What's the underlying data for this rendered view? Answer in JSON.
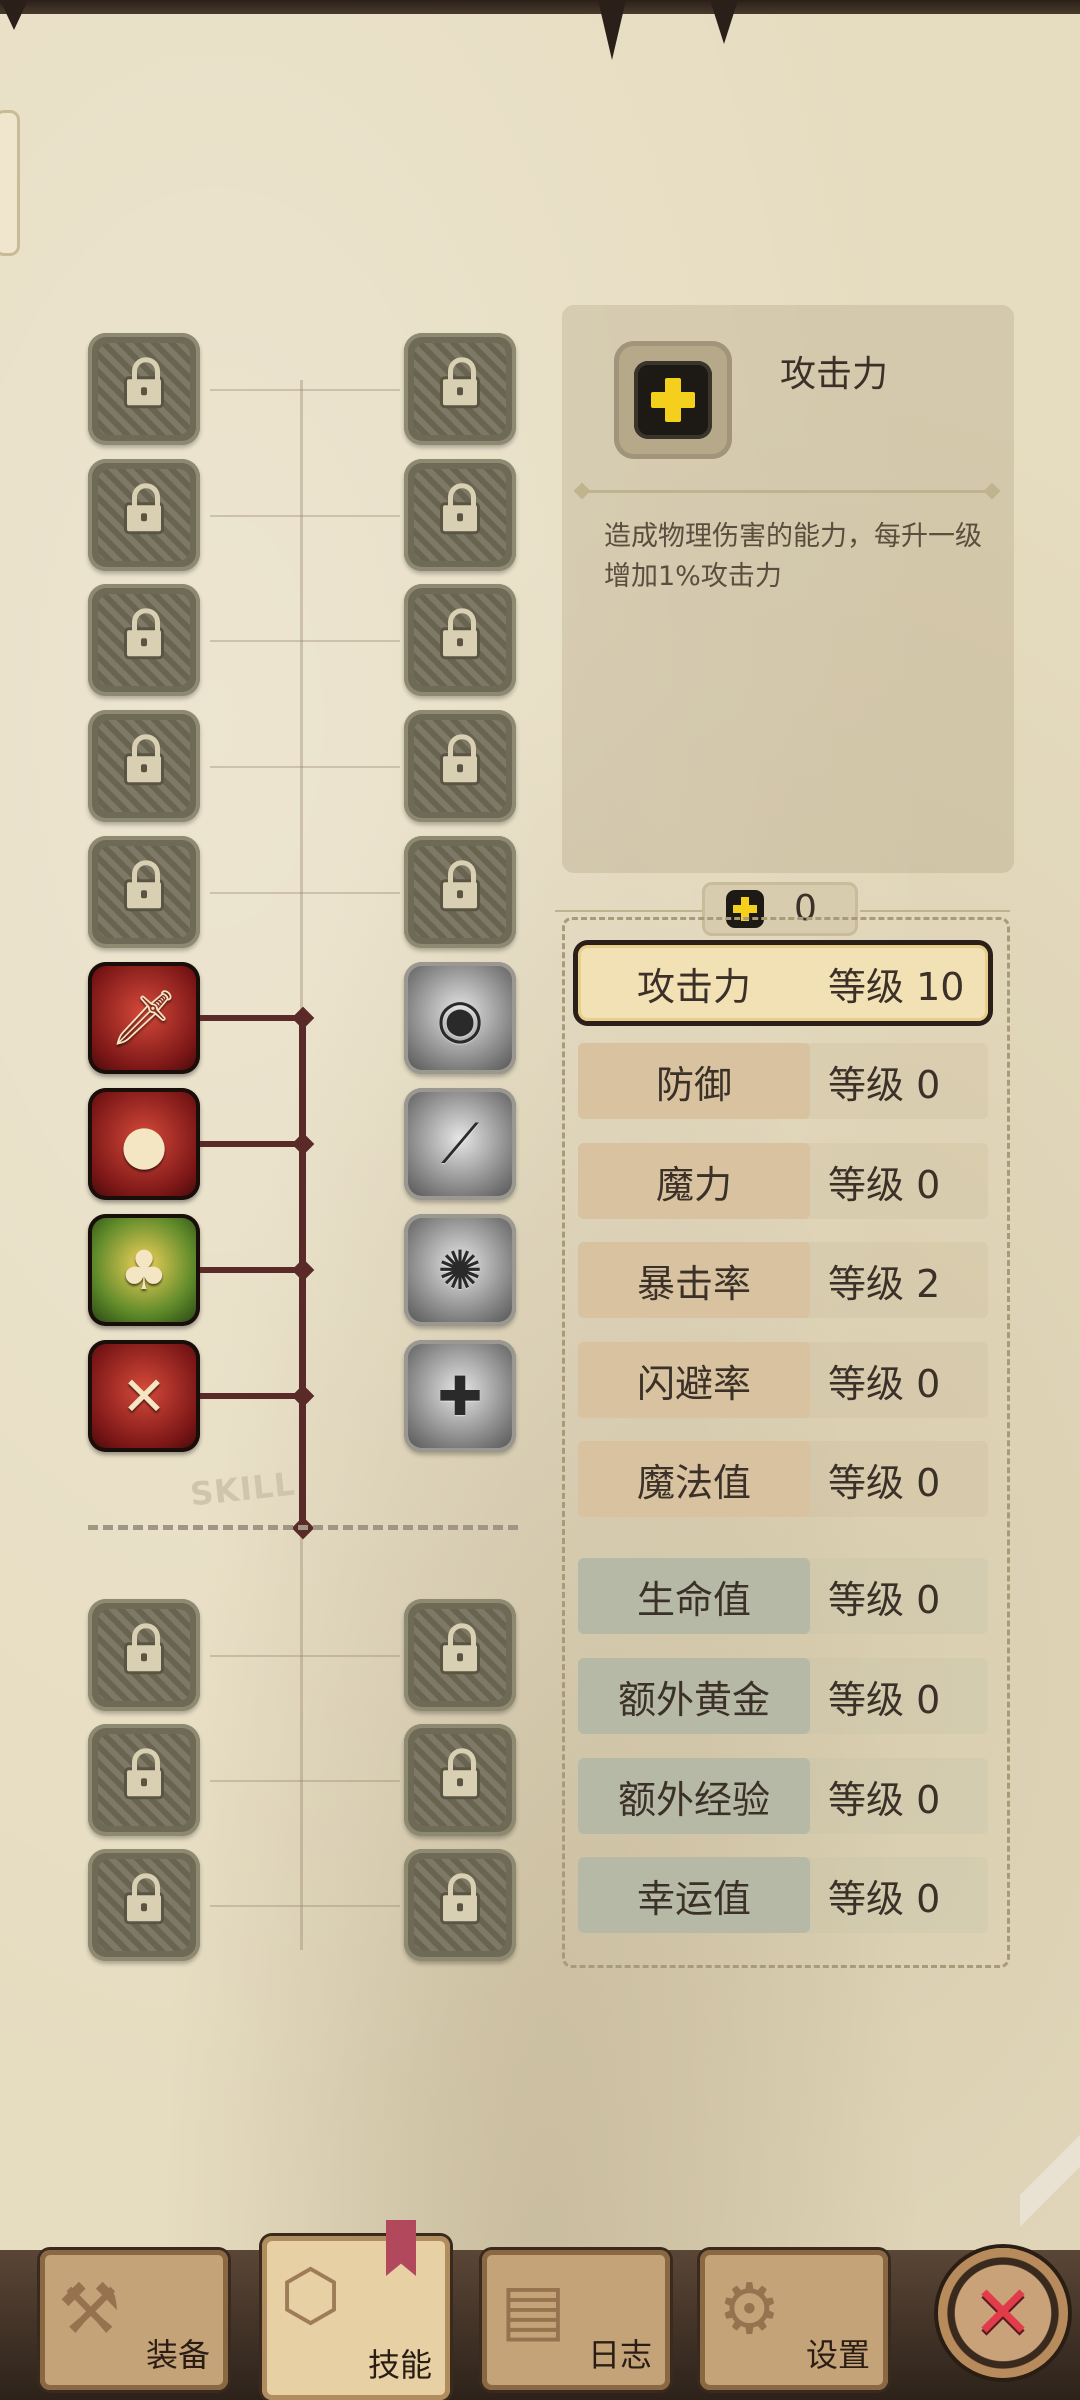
{
  "info": {
    "title": "攻击力",
    "description": "造成物理伤害的能力，每升一级增加1%攻击力"
  },
  "points": {
    "value": "0"
  },
  "skill_label": "SKILL",
  "stats": [
    {
      "name": "攻击力",
      "level": "等级 10",
      "group": "red",
      "selected": true
    },
    {
      "name": "防御",
      "level": "等级 0",
      "group": "red"
    },
    {
      "name": "魔力",
      "level": "等级 0",
      "group": "red"
    },
    {
      "name": "暴击率",
      "level": "等级 2",
      "group": "red"
    },
    {
      "name": "闪避率",
      "level": "等级 0",
      "group": "red"
    },
    {
      "name": "魔法值",
      "level": "等级 0",
      "group": "red"
    },
    {
      "name": "生命值",
      "level": "等级 0",
      "group": "blue"
    },
    {
      "name": "额外黄金",
      "level": "等级 0",
      "group": "blue"
    },
    {
      "name": "额外经验",
      "level": "等级 0",
      "group": "blue"
    },
    {
      "name": "幸运值",
      "level": "等级 0",
      "group": "blue"
    }
  ],
  "nav": {
    "equip": "装备",
    "skill": "技能",
    "log": "日志",
    "settings": "设置"
  },
  "colors": {
    "accent_yellow": "#f4cf1c",
    "skill_red": "#7a1616",
    "trunk": "#5a2a28",
    "close_red": "#e23c4b"
  }
}
